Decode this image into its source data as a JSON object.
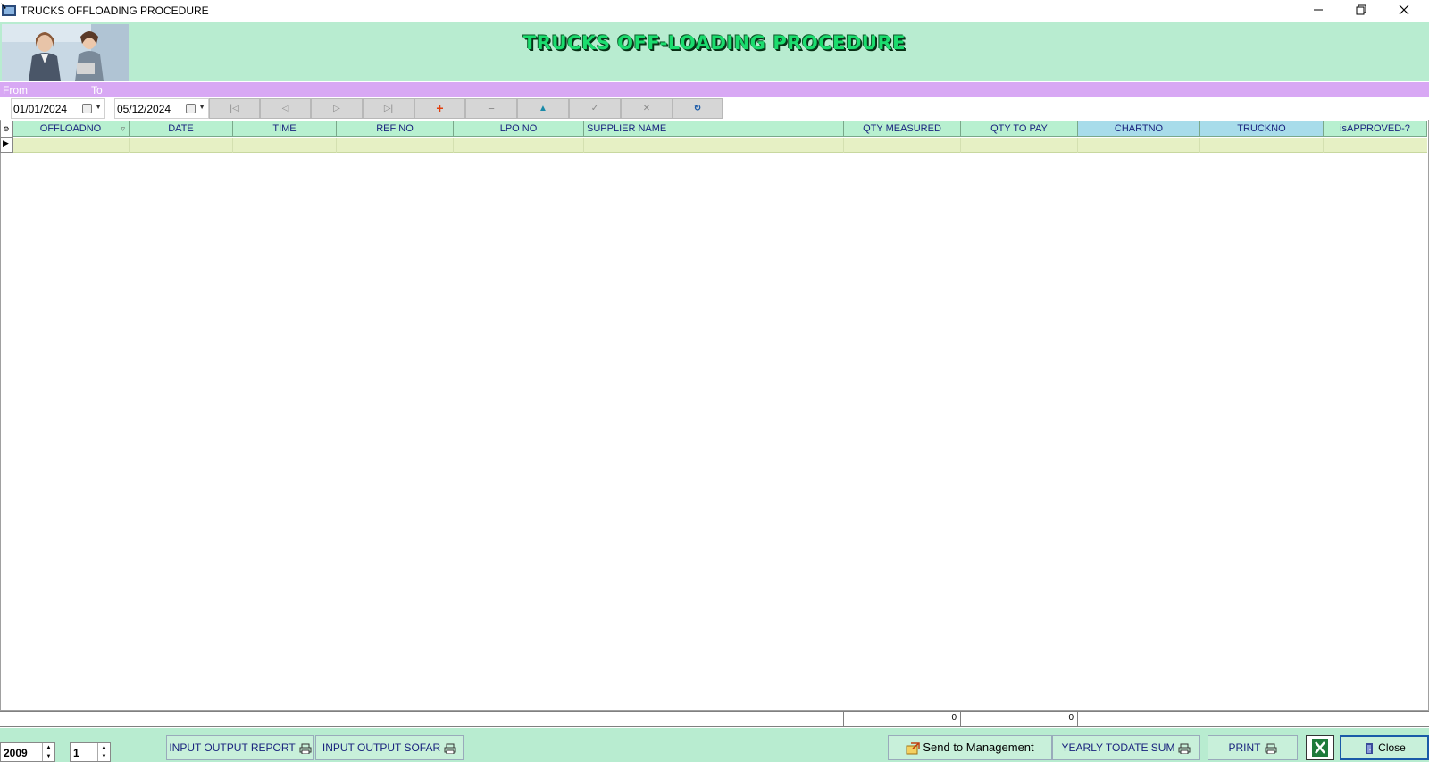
{
  "window": {
    "title": "TRUCKS OFFLOADING PROCEDURE",
    "minimize_icon": "minimize-icon",
    "maximize_icon": "restore-icon",
    "close_icon": "close-icon"
  },
  "header": {
    "title": "TRUCKS OFF-LOADING PROCEDURE",
    "photo_icon": "two-businesswomen-photo"
  },
  "range": {
    "from_label": "From",
    "to_label": "To",
    "from_date": "01/01/2024",
    "to_date": "05/12/2024"
  },
  "toolbar": {
    "first": "|◁",
    "prev": "◁",
    "next": "▷",
    "last": "▷|",
    "add": "+",
    "delete": "−",
    "edit": "▲",
    "post": "✓",
    "cancel": "✕",
    "refresh": "↻"
  },
  "grid": {
    "columns": [
      "OFFLOADNO",
      "DATE",
      "TIME",
      "REF NO",
      "LPO NO",
      "SUPPLIER NAME",
      "QTY MEASURED",
      "QTY TO PAY",
      "CHARTNO",
      "TRUCKNO",
      "isAPPROVED-?"
    ],
    "totals": {
      "qty_measured": "0",
      "qty_to_pay": "0"
    }
  },
  "footer": {
    "year": "2009",
    "period": "1",
    "input_output_report": "INPUT OUTPUT REPORT",
    "input_output_sofar": "INPUT OUTPUT SOFAR",
    "send_to_management": "Send to Management",
    "yearly_todate_sum": "YEARLY TODATE SUM",
    "print": "PRINT",
    "close": "Close"
  },
  "colors": {
    "header_band": "#b8ecd0",
    "range_bar": "#d8a8f4",
    "grid_header": "#b8f0d0",
    "grid_header_blue": "#a8dcea",
    "title_green": "#1bdc6e"
  }
}
